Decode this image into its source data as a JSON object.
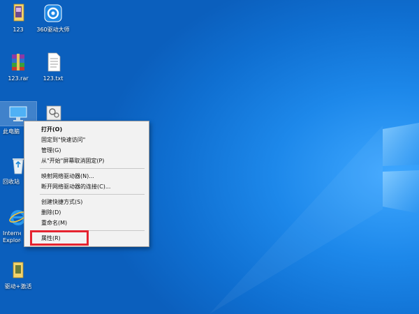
{
  "desktop_icons": [
    {
      "id": "folder-123",
      "label": "123",
      "icon": "folder-icon"
    },
    {
      "id": "driver-genius",
      "label": "360驱动大师",
      "icon": "gear-shield-icon"
    },
    {
      "id": "rar-123",
      "label": "123.rar",
      "icon": "archive-icon"
    },
    {
      "id": "txt-123",
      "label": "123.txt",
      "icon": "text-file-icon"
    },
    {
      "id": "this-pc",
      "label": "此电脑",
      "icon": "computer-icon"
    },
    {
      "id": "control-panel",
      "label": "",
      "icon": "control-panel-icon"
    },
    {
      "id": "recycle-bin",
      "label": "回收站",
      "icon": "recycle-bin-icon"
    },
    {
      "id": "ie",
      "label": "Internet Explorer",
      "icon": "ie-icon"
    },
    {
      "id": "driver-activate",
      "label": "驱动+激活",
      "icon": "folder-icon"
    }
  ],
  "context_menu": {
    "open": "打开(O)",
    "pin_quick": "固定到\"快速访问\"",
    "manage": "管理(G)",
    "unpin_start": "从\"开始\"屏幕取消固定(P)",
    "map_drive": "映射网络驱动器(N)...",
    "disconnect_drive": "断开网络驱动器的连接(C)...",
    "create_shortcut": "创建快捷方式(S)",
    "delete": "删除(D)",
    "rename": "重命名(M)",
    "properties": "属性(R)"
  },
  "colors": {
    "desktop_blue": "#0f6fd1",
    "highlight_red": "#e5232f",
    "menu_bg": "#f2f2f2"
  }
}
